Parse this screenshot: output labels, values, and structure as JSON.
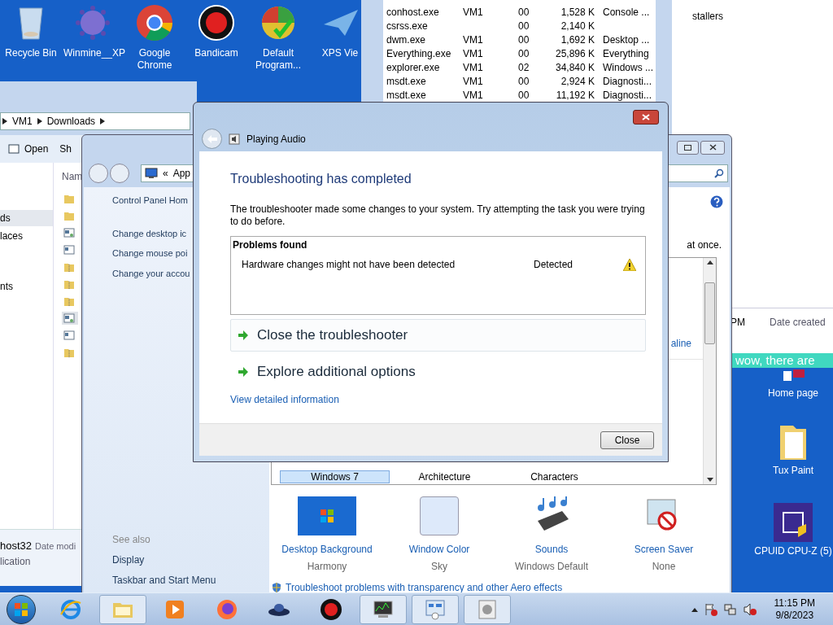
{
  "desktop_icons": [
    {
      "label": "Recycle Bin"
    },
    {
      "label": "Winmine__XP"
    },
    {
      "label": "Google Chrome"
    },
    {
      "label": "Bandicam"
    },
    {
      "label": "Default Program..."
    },
    {
      "label": "XPS Vie"
    }
  ],
  "task_manager": {
    "rows": [
      {
        "name": "conhost.exe",
        "user": "VM1",
        "cpu": "00",
        "memory": "1,528 K",
        "description": "Console ..."
      },
      {
        "name": "csrss.exe",
        "user": "",
        "cpu": "00",
        "memory": "2,140 K",
        "description": ""
      },
      {
        "name": "dwm.exe",
        "user": "VM1",
        "cpu": "00",
        "memory": "1,692 K",
        "description": "Desktop ..."
      },
      {
        "name": "Everything.exe",
        "user": "VM1",
        "cpu": "00",
        "memory": "25,896 K",
        "description": "Everything"
      },
      {
        "name": "explorer.exe",
        "user": "VM1",
        "cpu": "02",
        "memory": "34,840 K",
        "description": "Windows ..."
      },
      {
        "name": "msdt.exe",
        "user": "VM1",
        "cpu": "00",
        "memory": "2,924 K",
        "description": "Diagnosti..."
      },
      {
        "name": "msdt.exe",
        "user": "VM1",
        "cpu": "00",
        "memory": "11,192 K",
        "description": "Diagnosti..."
      }
    ]
  },
  "background_window": {
    "text": "stallers"
  },
  "file_list_window": {
    "cell": "PM",
    "column_header": "Date created"
  },
  "banner": {
    "text": "wow, there are"
  },
  "right_desktop_icons": [
    {
      "label": "Home page"
    },
    {
      "label": "Tux Paint"
    },
    {
      "label": "CPUID CPU-Z (5)"
    }
  ],
  "explorer": {
    "breadcrumb": [
      "VM1",
      "Downloads"
    ],
    "toolbar": [
      "Open",
      "Sh"
    ],
    "nav_items": [
      {
        "label": "ds",
        "selected": true
      },
      {
        "label": "laces",
        "selected": false
      },
      {
        "label": "nts",
        "selected": false
      }
    ],
    "column_header": "Nam",
    "files": [
      {
        "kind": "folder",
        "selected": false
      },
      {
        "kind": "folder",
        "selected": false
      },
      {
        "kind": "app",
        "selected": false
      },
      {
        "kind": "window",
        "selected": false
      },
      {
        "kind": "zip",
        "selected": false
      },
      {
        "kind": "zip",
        "selected": false
      },
      {
        "kind": "zip",
        "selected": false
      },
      {
        "kind": "app",
        "selected": true
      },
      {
        "kind": "window",
        "selected": false
      },
      {
        "kind": "zip",
        "selected": false
      }
    ],
    "status": {
      "name": "host32",
      "meta": "Date modi",
      "type": "lication"
    }
  },
  "control_panel": {
    "address_prefix": "«",
    "address": "App",
    "left_links": [
      "Control Panel Hom",
      "Change desktop ic",
      "Change mouse poi",
      "Change your accou"
    ],
    "see_also_heading": "See also",
    "see_also": [
      "Display",
      "Taskbar and Start Menu"
    ],
    "intro_tail": "at once.",
    "online_link": "aline",
    "themes": [
      {
        "label": "Windows 7",
        "selected": true
      },
      {
        "label": "Architecture",
        "selected": false
      },
      {
        "label": "Characters",
        "selected": false
      }
    ],
    "settings": [
      {
        "kind": "background",
        "title": "Desktop Background",
        "value": "Harmony"
      },
      {
        "kind": "color",
        "title": "Window Color",
        "value": "Sky"
      },
      {
        "kind": "sounds",
        "title": "Sounds",
        "value": "Windows Default"
      },
      {
        "kind": "screensaver",
        "title": "Screen Saver",
        "value": "None"
      }
    ],
    "aero_link": "Troubleshoot problems with transparency and other Aero effects"
  },
  "dialog": {
    "title": "Playing Audio",
    "heading": "Troubleshooting has completed",
    "message": "The troubleshooter made some changes to your system. Try attempting the task you were trying to do before.",
    "problems_heading": "Problems found",
    "problems": [
      {
        "text": "Hardware changes might not have been detected",
        "status": "Detected",
        "kind": "warning"
      }
    ],
    "actions": [
      {
        "label": "Close the troubleshooter",
        "highlighted": true
      },
      {
        "label": "Explore additional options",
        "highlighted": false
      }
    ],
    "details_link": "View detailed information",
    "close_button": "Close"
  },
  "taskbar": {
    "apps": [
      {
        "kind": "ie",
        "open": false
      },
      {
        "kind": "explorer",
        "open": true
      },
      {
        "kind": "media",
        "open": false
      },
      {
        "kind": "firefox",
        "open": false
      },
      {
        "kind": "ufo",
        "open": false
      },
      {
        "kind": "record",
        "open": false
      },
      {
        "kind": "taskmgr",
        "open": true
      },
      {
        "kind": "controlpanel",
        "open": true
      },
      {
        "kind": "sound",
        "open": true
      }
    ],
    "clock": {
      "time": "11:15 PM",
      "date": "9/8/2023"
    }
  }
}
